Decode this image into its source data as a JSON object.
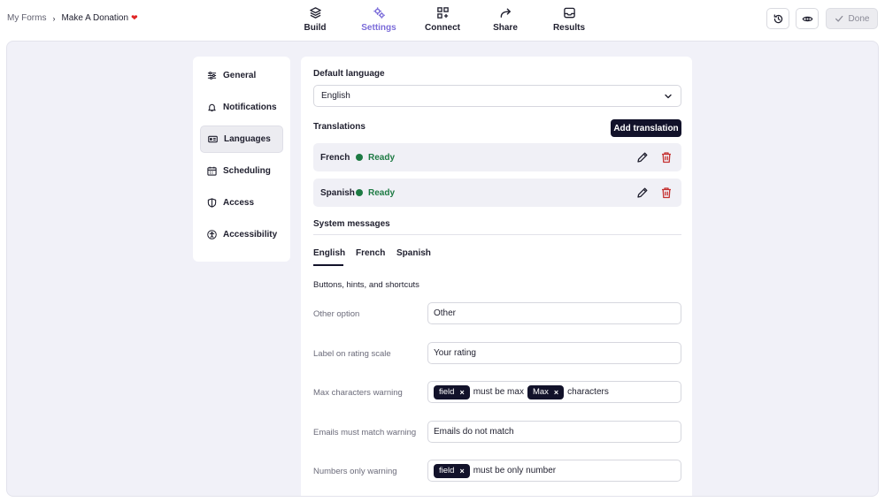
{
  "breadcrumb": {
    "root": "My Forms",
    "separator": "›",
    "current": "Make A Donation",
    "emoji": "❤"
  },
  "nav": {
    "build": "Build",
    "settings": "Settings",
    "connect": "Connect",
    "share": "Share",
    "results": "Results",
    "active": "Settings"
  },
  "toolbar": {
    "done_label": "Done"
  },
  "settings_menu": {
    "general": "General",
    "notifications": "Notifications",
    "languages": "Languages",
    "scheduling": "Scheduling",
    "access": "Access",
    "accessibility": "Accessibility",
    "active": "Languages"
  },
  "languages": {
    "default_language_title": "Default language",
    "default_language_value": "English",
    "translations_title": "Translations",
    "add_translation_label": "Add translation",
    "translations": [
      {
        "language": "French",
        "status": "Ready"
      },
      {
        "language": "Spanish",
        "status": "Ready"
      }
    ],
    "system_messages_title": "System messages",
    "tabs": [
      "English",
      "French",
      "Spanish"
    ],
    "active_tab": "English",
    "section_title": "Buttons, hints, and shortcuts",
    "fields": [
      {
        "label": "Other option",
        "value": "Other"
      },
      {
        "label": "Label on rating scale",
        "value": "Your rating"
      },
      {
        "label": "Max characters warning",
        "chip1": "field",
        "text1": "must be max",
        "chip2": "Max",
        "text2": "characters"
      },
      {
        "label": "Emails must match warning",
        "value": "Emails do not match"
      },
      {
        "label": "Numbers only warning",
        "chip1": "field",
        "text1": "must be only number"
      }
    ],
    "chip_remove": "×"
  },
  "colors": {
    "accent": "#7b6cd9",
    "dark": "#12122a",
    "status_ready": "#1d7a43",
    "delete": "#c53030",
    "canvas_bg": "#f1f1f8"
  }
}
